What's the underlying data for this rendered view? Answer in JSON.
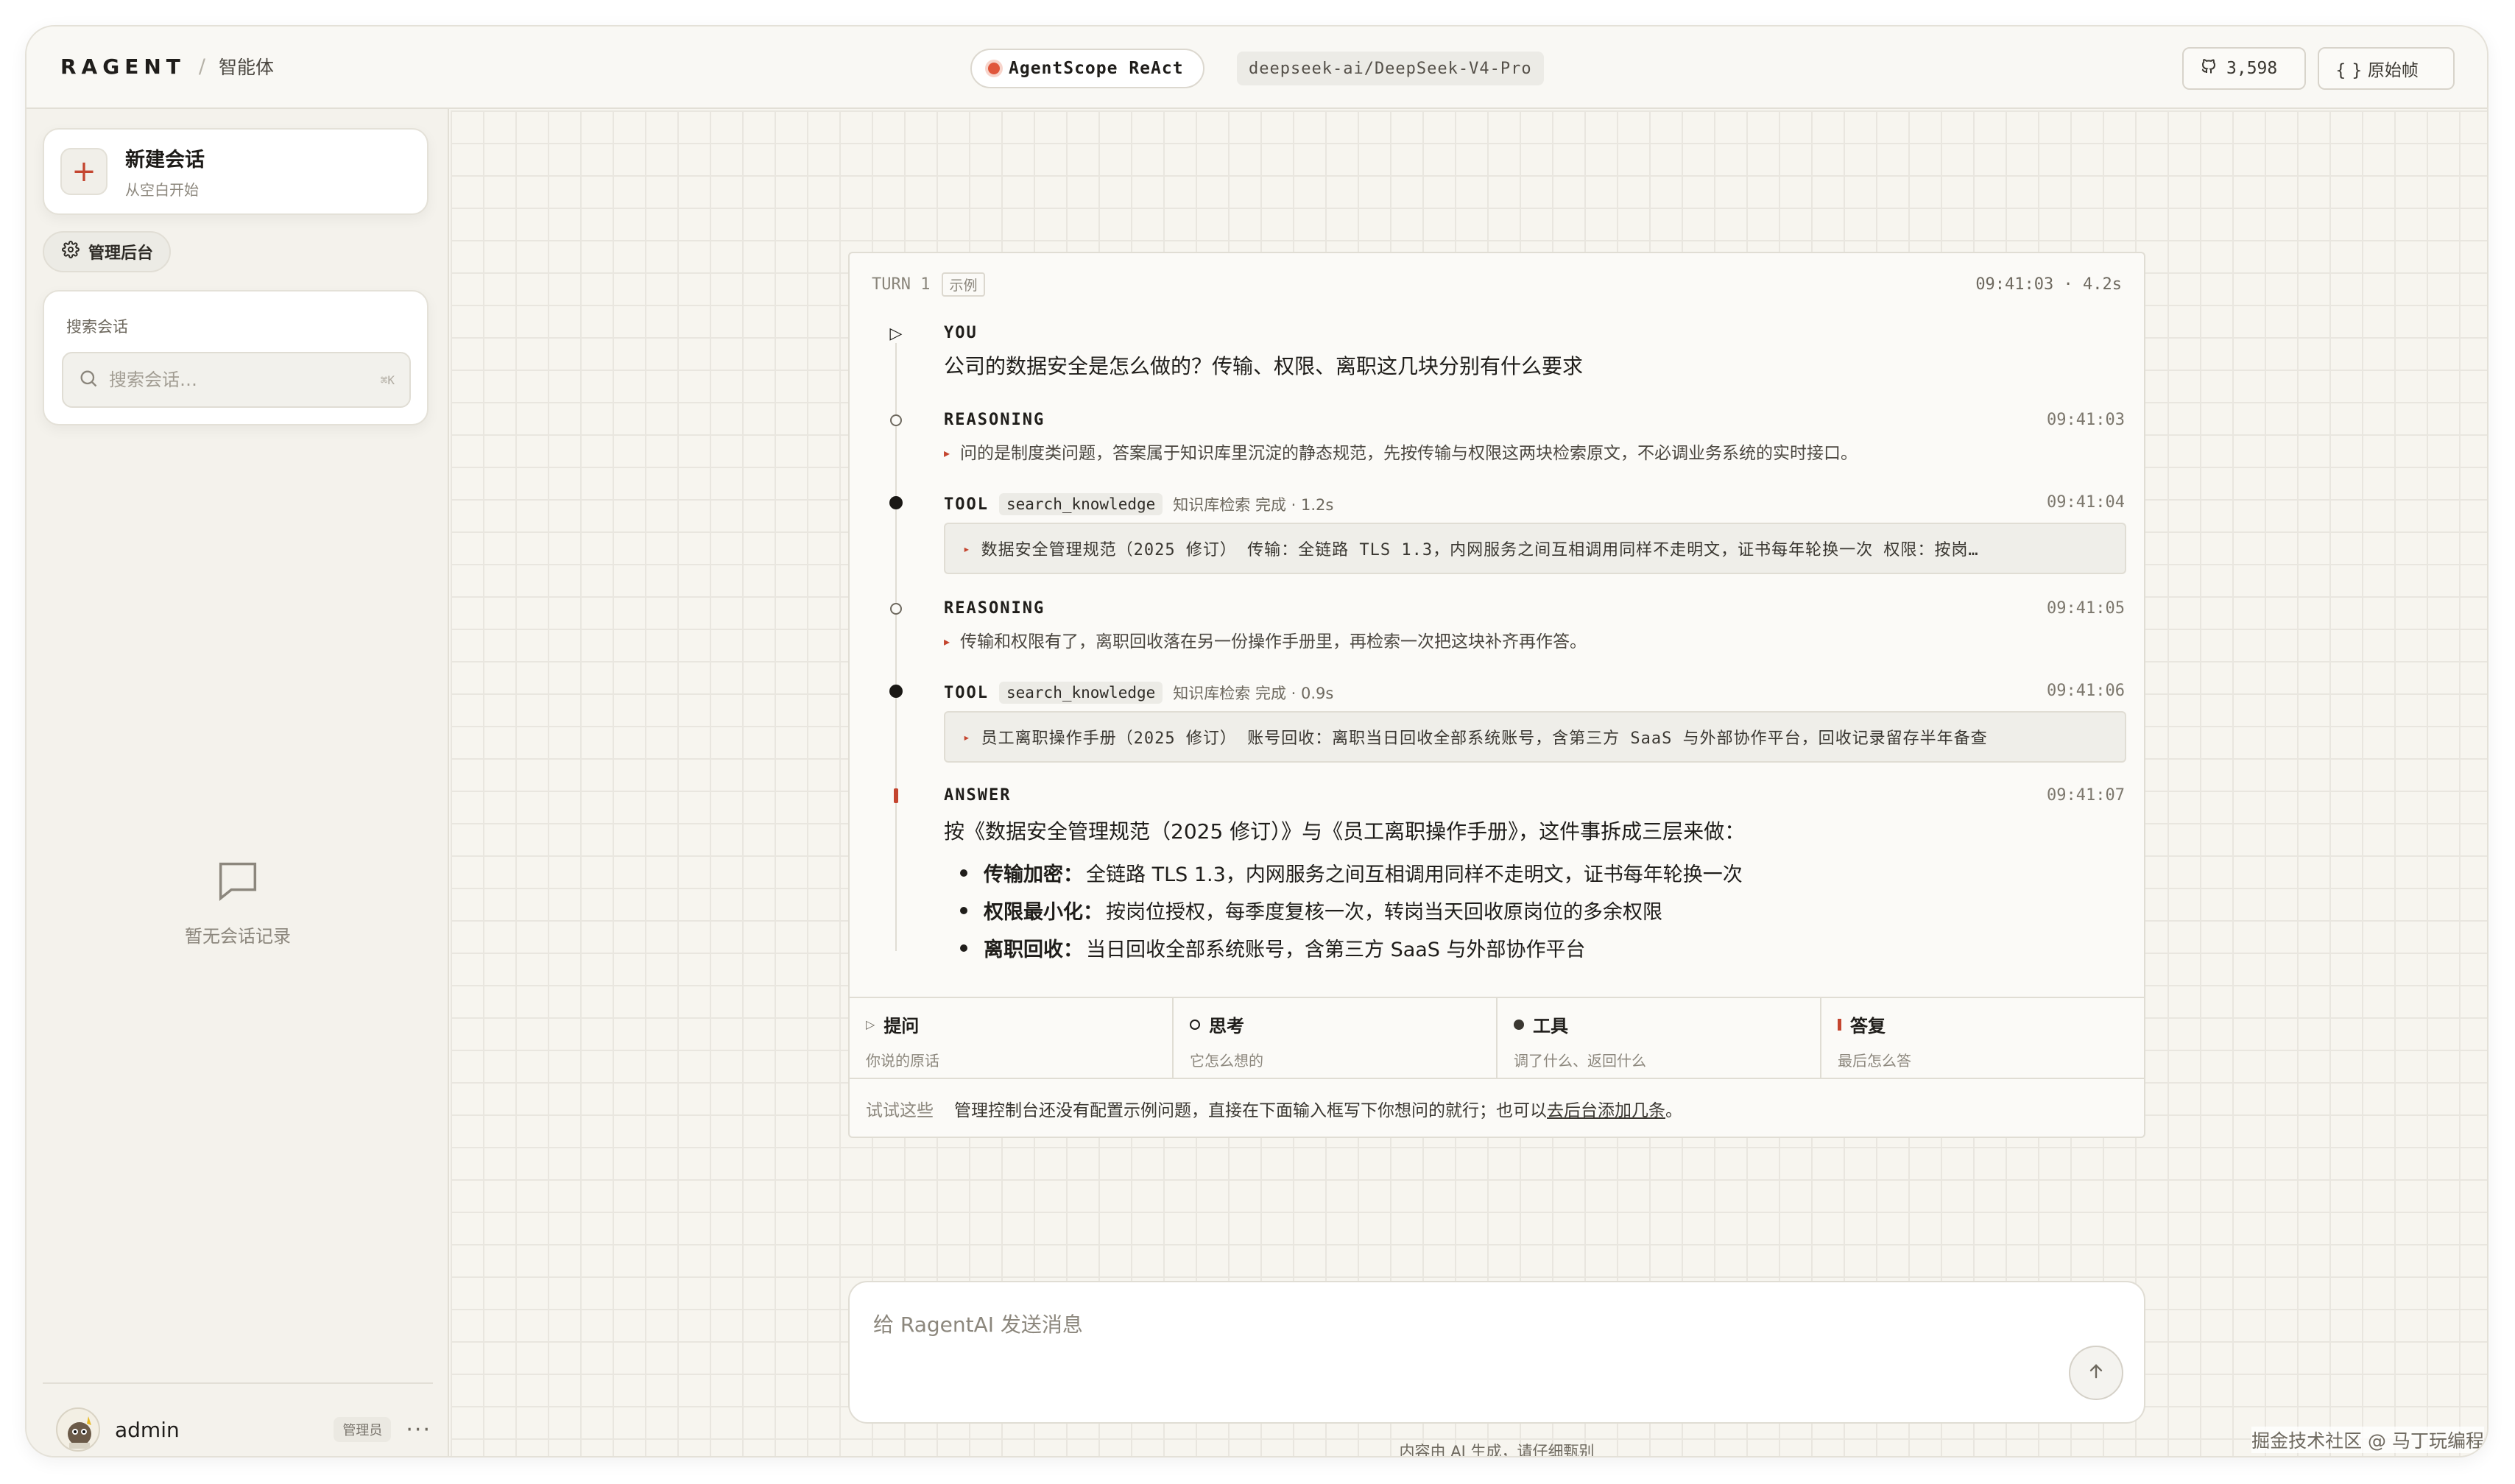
{
  "header": {
    "logo": "RAGENT",
    "separator": "/",
    "subtitle": "智能体",
    "agent_label": "AgentScope ReAct",
    "model": "deepseek-ai/DeepSeek-V4-Pro",
    "stars": "3,598",
    "raw_label": "{ } 原始帧"
  },
  "sidebar": {
    "new_chat_title": "新建会话",
    "new_chat_sub": "从空白开始",
    "admin_label": "管理后台",
    "search_label": "搜索会话",
    "search_placeholder": "搜索会话…",
    "search_shortcut": "⌘K",
    "empty_text": "暂无会话记录",
    "user": {
      "name": "admin",
      "role": "管理员"
    }
  },
  "turn": {
    "title": "TURN 1",
    "badge": "示例",
    "time": "09:41:03 · 4.2s",
    "you": {
      "label": "YOU",
      "text": "公司的数据安全是怎么做的？传输、权限、离职这几块分别有什么要求"
    },
    "steps": [
      {
        "label": "REASONING",
        "time": "09:41:03",
        "text": "问的是制度类问题，答案属于知识库里沉淀的静态规范，先按传输与权限这两块检索原文，不必调业务系统的实时接口。"
      },
      {
        "label": "TOOL",
        "name": "search_knowledge",
        "meta": "知识库检索  完成  · 1.2s",
        "time": "09:41:04",
        "result": "数据安全管理规范（2025 修订） 传输：全链路 TLS 1.3，内网服务之间互相调用同样不走明文，证书每年轮换一次 权限：按岗…"
      },
      {
        "label": "REASONING",
        "time": "09:41:05",
        "text": "传输和权限有了，离职回收落在另一份操作手册里，再检索一次把这块补齐再作答。"
      },
      {
        "label": "TOOL",
        "name": "search_knowledge",
        "meta": "知识库检索  完成  · 0.9s",
        "time": "09:41:06",
        "result": "员工离职操作手册（2025 修订） 账号回收：离职当日回收全部系统账号，含第三方 SaaS 与外部协作平台，回收记录留存半年备查"
      }
    ],
    "answer": {
      "label": "ANSWER",
      "time": "09:41:07",
      "intro": "按《数据安全管理规范（2025 修订）》与《员工离职操作手册》，这件事拆成三层来做：",
      "items": [
        {
          "title": "传输加密：",
          "text": "全链路 TLS 1.3，内网服务之间互相调用同样不走明文，证书每年轮换一次"
        },
        {
          "title": "权限最小化：",
          "text": "按岗位授权，每季度复核一次，转岗当天回收原岗位的多余权限"
        },
        {
          "title": "离职回收：",
          "text": "当日回收全部系统账号，含第三方 SaaS 与外部协作平台"
        }
      ]
    },
    "legend": [
      {
        "title": "提问",
        "sub": "你说的原话"
      },
      {
        "title": "思考",
        "sub": "它怎么想的"
      },
      {
        "title": "工具",
        "sub": "调了什么、返回什么"
      },
      {
        "title": "答复",
        "sub": "最后怎么答"
      }
    ],
    "try": {
      "label": "试试这些",
      "text": "管理控制台还没有配置示例问题，直接在下面输入框写下你想问的就行；也可以",
      "link": "去后台添加几条",
      "end": "。"
    }
  },
  "composer": {
    "placeholder": "给 RagentAI 发送消息",
    "disclaimer": "内容由 AI 生成，请仔细甄别"
  },
  "watermark": "掘金技术社区 @ 马丁玩编程"
}
